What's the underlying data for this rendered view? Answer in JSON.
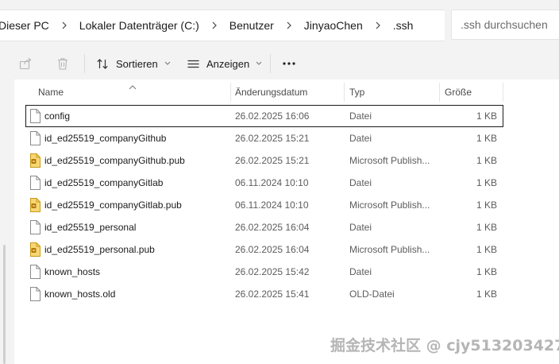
{
  "address_bar": {
    "crumbs": [
      "Dieser PC",
      "Lokaler Datenträger (C:)",
      "Benutzer",
      "JinyaoChen",
      ".ssh"
    ],
    "search_placeholder": ".ssh durchsuchen"
  },
  "toolbar": {
    "sort_label": "Sortieren",
    "view_label": "Anzeigen"
  },
  "columns": {
    "name": "Name",
    "modified": "Änderungsdatum",
    "type": "Typ",
    "size": "Größe"
  },
  "files": [
    {
      "name": "config",
      "modified": "26.02.2025 16:06",
      "type": "Datei",
      "size": "1 KB",
      "icon": "file-icon",
      "selected": true
    },
    {
      "name": "id_ed25519_companyGithub",
      "modified": "26.02.2025 15:21",
      "type": "Datei",
      "size": "1 KB",
      "icon": "file-icon"
    },
    {
      "name": "id_ed25519_companyGithub.pub",
      "modified": "26.02.2025 15:21",
      "type": "Microsoft Publish...",
      "size": "1 KB",
      "icon": "publisher-file-icon"
    },
    {
      "name": "id_ed25519_companyGitlab",
      "modified": "06.11.2024 10:10",
      "type": "Datei",
      "size": "1 KB",
      "icon": "file-icon"
    },
    {
      "name": "id_ed25519_companyGitlab.pub",
      "modified": "06.11.2024 10:10",
      "type": "Microsoft Publish...",
      "size": "1 KB",
      "icon": "publisher-file-icon"
    },
    {
      "name": "id_ed25519_personal",
      "modified": "26.02.2025 16:04",
      "type": "Datei",
      "size": "1 KB",
      "icon": "file-icon"
    },
    {
      "name": "id_ed25519_personal.pub",
      "modified": "26.02.2025 16:04",
      "type": "Microsoft Publish...",
      "size": "1 KB",
      "icon": "publisher-file-icon"
    },
    {
      "name": "known_hosts",
      "modified": "26.02.2025 15:42",
      "type": "Datei",
      "size": "1 KB",
      "icon": "file-icon"
    },
    {
      "name": "known_hosts.old",
      "modified": "26.02.2025 15:41",
      "type": "OLD-Datei",
      "size": "1 KB",
      "icon": "file-icon"
    }
  ],
  "watermark": "掘金技术社区 @ cjy513203427"
}
